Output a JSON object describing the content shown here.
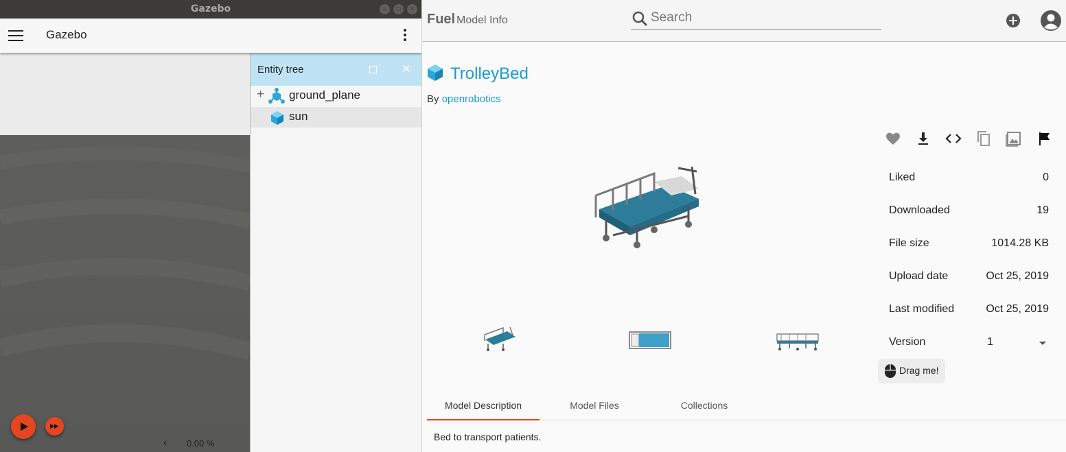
{
  "gazebo": {
    "window_title": "Gazebo",
    "app_title": "Gazebo",
    "entity_tree": {
      "title": "Entity tree",
      "items": [
        {
          "label": "ground_plane"
        },
        {
          "label": "sun"
        }
      ]
    },
    "rtf": "0.00 %"
  },
  "fuel": {
    "brand": "Fuel",
    "subtitle": "Model Info",
    "search_placeholder": "Search",
    "model_name": "TrolleyBed",
    "by_label": "By",
    "owner": "openrobotics",
    "info": [
      {
        "key": "Liked",
        "value": "0"
      },
      {
        "key": "Downloaded",
        "value": "19"
      },
      {
        "key": "File size",
        "value": "1014.28 KB"
      },
      {
        "key": "Upload date",
        "value": "Oct 25, 2019"
      },
      {
        "key": "Last modified",
        "value": "Oct 25, 2019"
      }
    ],
    "version_label": "Version",
    "version_value": "1",
    "drag_label": "Drag me!",
    "tabs": [
      {
        "label": "Model Description"
      },
      {
        "label": "Model Files"
      },
      {
        "label": "Collections"
      }
    ],
    "description": "Bed to transport patients.",
    "accent": "#e5461f",
    "link_color": "#1a9bd1",
    "header_bg": "#bfe3f5"
  }
}
